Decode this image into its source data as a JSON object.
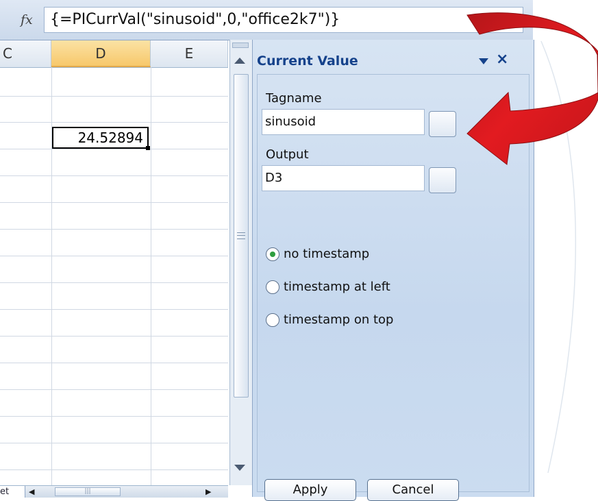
{
  "formula_bar": {
    "fx_label": "fx",
    "formula": "{=PICurrVal(\"sinusoid\",0,\"office2k7\")}"
  },
  "sheet": {
    "columns": [
      "C",
      "D",
      "E"
    ],
    "active_cell_value": "24.52894",
    "sheet_tab_label": "et"
  },
  "task_pane": {
    "title": "Current Value",
    "tagname_label": "Tagname",
    "tagname_value": "sinusoid",
    "output_label": "Output",
    "output_value": "D3",
    "radio_options": [
      "no timestamp",
      "timestamp at left",
      "timestamp on top"
    ],
    "selected_option": "no timestamp",
    "apply_label": "Apply",
    "cancel_label": "Cancel"
  },
  "colors": {
    "pane_title": "#15428b",
    "selected_column_header": "#f7c86b",
    "annotation_arrow": "#d9161c",
    "radio_selected": "#2f9e3f"
  },
  "icons": [
    "fx-icon",
    "dropdown-icon",
    "close-icon",
    "scroll-up-icon",
    "scroll-down-icon",
    "scroll-left-icon",
    "scroll-right-icon",
    "red-curved-arrow"
  ]
}
